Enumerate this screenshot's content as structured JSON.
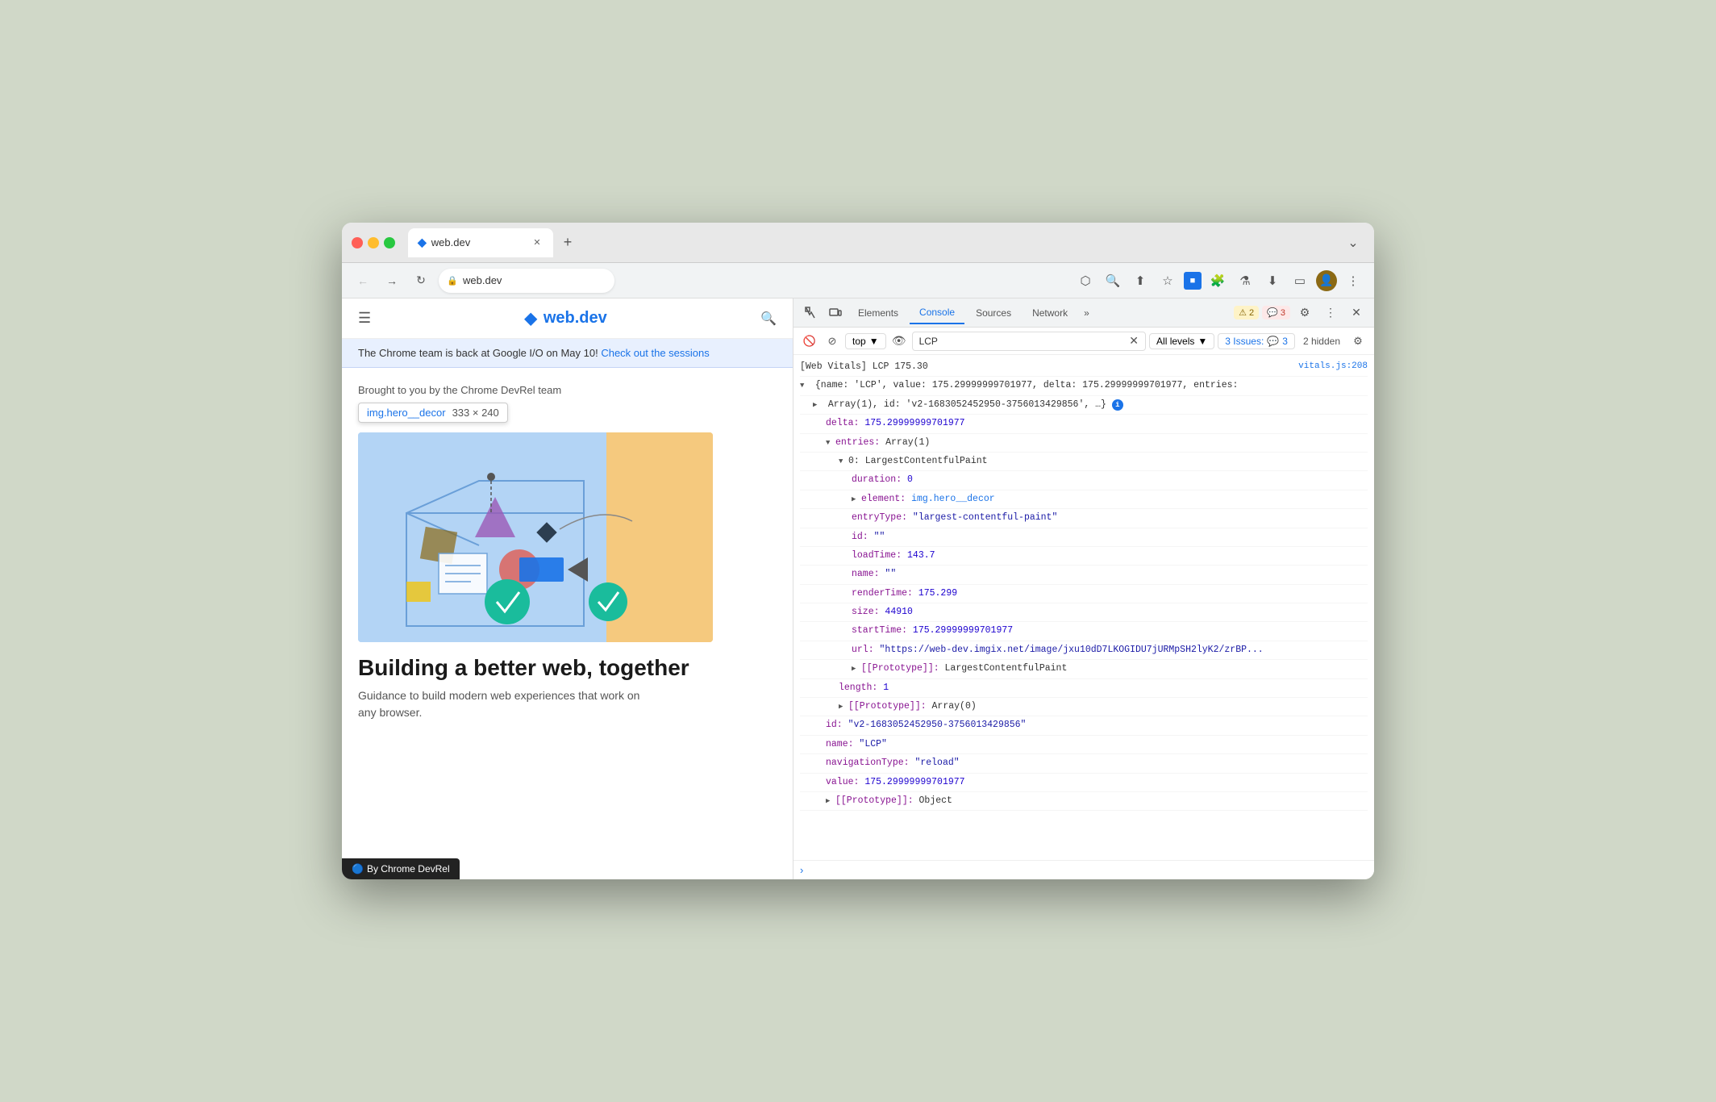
{
  "browser": {
    "tab_title": "web.dev",
    "tab_favicon": "◆",
    "address": "web.dev",
    "new_tab_label": "+",
    "chevron_down": "⌄"
  },
  "webpage": {
    "site_name": "web.dev",
    "announcement": "The Chrome team is back at Google I/O on May 10!",
    "announcement_link": "Check out the sessions",
    "label": "Brought to you by the Chrome DevRel team",
    "element_class": "img.hero__decor",
    "element_dims": "333 × 240",
    "heading": "Building a better web, together",
    "subtext": "Guidance to build modern web experiences that work on\nany browser.",
    "footer": "By  Chrome DevRel"
  },
  "devtools": {
    "tabs": [
      "Elements",
      "Console",
      "Sources",
      "Network"
    ],
    "active_tab": "Console",
    "more_tabs": "»",
    "warning_count": "2",
    "error_count": "3",
    "context": "top",
    "filter_value": "LCP",
    "levels": "All levels",
    "issues_count": "3 Issues:",
    "issues_icon_count": "3",
    "hidden_count": "2 hidden",
    "console_output": {
      "line1_text": "[Web Vitals] LCP 175.30",
      "line1_source": "vitals.js:208",
      "obj_preview": "{name: 'LCP', value: 175.29999999701977, delta: 175.29999999701977, entries:",
      "array_line": "Array(1), id: 'v2-1683052452950-3756013429856', …}",
      "delta_label": "delta:",
      "delta_value": "175.29999999701977",
      "entries_label": "entries:",
      "entries_value": "Array(1)",
      "entry_0": "0: LargestContentfulPaint",
      "duration_label": "duration:",
      "duration_value": "0",
      "element_label": "element:",
      "element_value": "img.hero__decor",
      "entryType_label": "entryType:",
      "entryType_value": "\"largest-contentful-paint\"",
      "id_label": "id:",
      "id_value": "\"\"",
      "loadTime_label": "loadTime:",
      "loadTime_value": "143.7",
      "name_label": "name:",
      "name_value": "\"\"",
      "renderTime_label": "renderTime:",
      "renderTime_value": "175.299",
      "size_label": "size:",
      "size_value": "44910",
      "startTime_label": "startTime:",
      "startTime_value": "175.29999999701977",
      "url_label": "url:",
      "url_value": "\"https://web-dev.imgix.net/image/jxu10dD7LKOGIDU7jURMpSH2lyK2/zrBP...",
      "proto1_label": "[[Prototype]]:",
      "proto1_value": "LargestContentfulPaint",
      "length_label": "length:",
      "length_value": "1",
      "proto2_label": "[[Prototype]]:",
      "proto2_value": "Array(0)",
      "id2_label": "id:",
      "id2_value": "\"v2-1683052452950-3756013429856\"",
      "name2_label": "name:",
      "name2_value": "\"LCP\"",
      "navType_label": "navigationType:",
      "navType_value": "\"reload\"",
      "value_label": "value:",
      "value_value": "175.29999999701977",
      "proto3_label": "[[Prototype]]:",
      "proto3_value": "Object"
    }
  }
}
